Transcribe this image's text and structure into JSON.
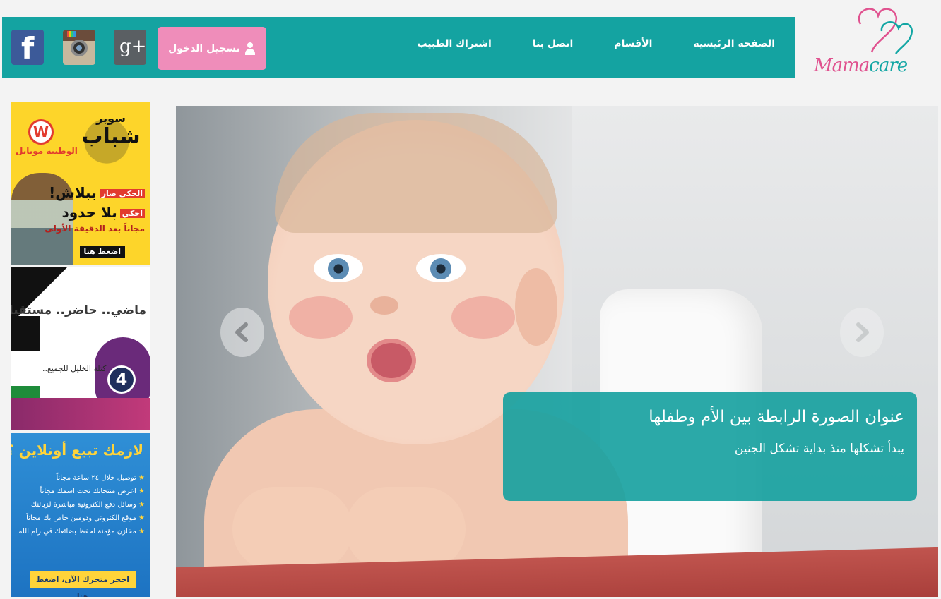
{
  "logo": {
    "text_mama": "Mama",
    "text_care": "care"
  },
  "nav": {
    "items": [
      {
        "label": "الصفحة الرئيسية"
      },
      {
        "label": "الأقسام"
      },
      {
        "label": "اتصل بنا"
      },
      {
        "label": "اشتراك الطبيب"
      }
    ],
    "login_label": "تسجيل الدخول",
    "social": [
      {
        "icon": "facebook-icon",
        "glyph": "f"
      },
      {
        "icon": "instagram-icon"
      },
      {
        "icon": "google-plus-icon",
        "glyph": "g+"
      }
    ]
  },
  "slider": {
    "caption_title": "عنوان الصورة الرابطة بين الأم وطفلها",
    "caption_text": "يبدأ تشكلها منذ بداية تشكل الجنين"
  },
  "ads": {
    "ad1": {
      "brand": "الوطنية موبايل",
      "brand_glyph": "W",
      "headline_small": "سوبر",
      "headline": "شباب",
      "tag1": "الحكي صار",
      "line1": "ببلاش!",
      "tag2": "احكي",
      "line2": "بلا حدود",
      "line3": "مجاناً بعد الدقيقة الأولى",
      "cta": "اضغط هنا"
    },
    "ad2": {
      "title": "ماضي.. حاضر.. مستقبل",
      "subtitle": "كتلة الخليل للجميع..",
      "number": "4"
    },
    "ad3": {
      "title": "لازمك تبيع أونلاين ؟",
      "items": [
        "توصيل خلال ٢٤ ساعة مجاناً",
        "اعرض منتجاتك تحت اسمك مجاناً",
        "وسائل دفع الكترونية مباشرة لزبائنك",
        "موقع الكتروني ودومين خاص بك مجاناً",
        "مخازن مؤمنة لحفظ بضائعك في رام الله"
      ],
      "cta": "احجز متجرك الآن، اضغط هنا"
    }
  },
  "colors": {
    "nav_bg": "#14a3a1",
    "login_bg": "#ef8dba",
    "logo_pink": "#e0528f",
    "logo_teal": "#12a6a4",
    "caption_bg": "#14a09e"
  }
}
